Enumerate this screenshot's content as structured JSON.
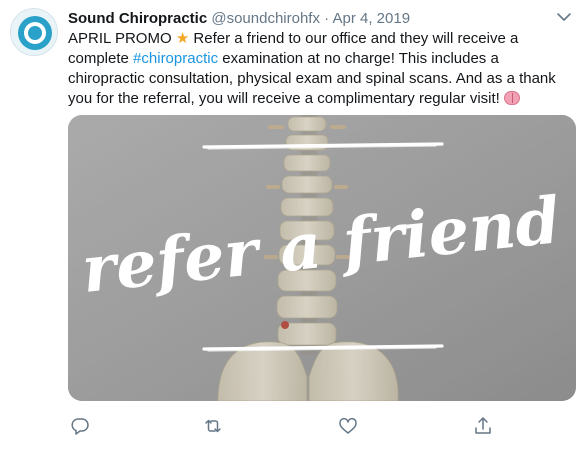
{
  "tweet": {
    "display_name": "Sound Chiropractic",
    "handle": "@soundchirohfx",
    "separator": "·",
    "date": "Apr 4, 2019",
    "text_part1": "APRIL PROMO ",
    "star_emoji": "★",
    "text_part2": " Refer a friend to our office and they will receive a complete ",
    "hashtag": "#chiropractic",
    "text_part3": " examination at no charge! This includes a chiropractic consultation, physical exam and spinal scans. And as a thank you for the referral, you will receive a complimentary regular visit! ",
    "brain_emoji_icon": "brain-emoji-icon"
  },
  "media": {
    "overlay_text": "refer a friend",
    "overlay_color": "#ffffff",
    "background_color": "#a6a6a6"
  },
  "actions": {
    "icons": [
      "reply-icon",
      "retweet-icon",
      "like-icon",
      "share-icon"
    ]
  },
  "colors": {
    "avatar_accent": "#2aa1c8",
    "hashtag": "#1b95e0",
    "meta_text": "#657786",
    "icon": "#657786"
  }
}
